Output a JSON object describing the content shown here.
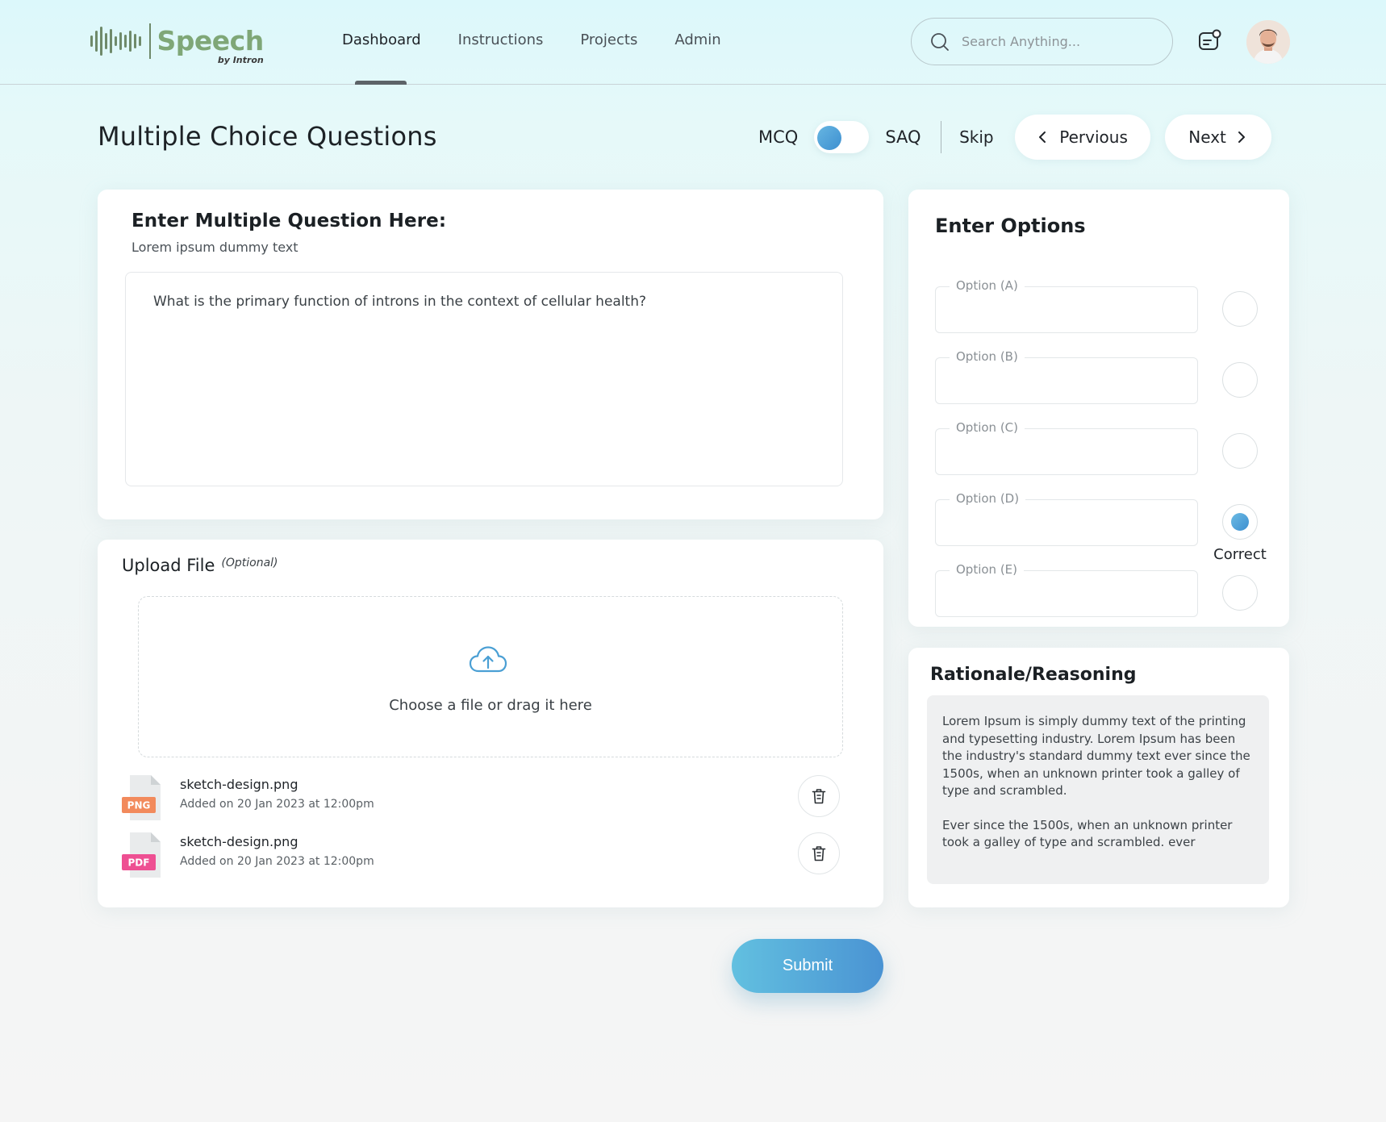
{
  "brand": {
    "name": "Speech",
    "sub": "by Intron",
    "color": "#7fa777"
  },
  "nav": {
    "items": [
      {
        "label": "Dashboard",
        "active": true
      },
      {
        "label": "Instructions",
        "active": false
      },
      {
        "label": "Projects",
        "active": false
      },
      {
        "label": "Admin",
        "active": false
      }
    ]
  },
  "search": {
    "placeholder": "Search Anything...",
    "icon": "search-icon"
  },
  "header_icons": {
    "messages": "message-icon",
    "avatar": "user-avatar"
  },
  "page": {
    "title": "Multiple Choice Questions"
  },
  "mode": {
    "left": "MCQ",
    "right": "SAQ",
    "selected": "MCQ"
  },
  "actions": {
    "skip": "Skip",
    "previous": "Pervious",
    "next": "Next",
    "submit": "Submit"
  },
  "question": {
    "title": "Enter Multiple Question Here:",
    "subtitle": "Lorem ipsum dummy text",
    "value": "What is the primary function of introns in the context of cellular health?"
  },
  "upload": {
    "title": "Upload File",
    "optional": "(Optional)",
    "drop_text": "Choose a file or drag it here",
    "files": [
      {
        "name": "sketch-design.png",
        "meta": "Added on 20 Jan 2023 at 12:00pm",
        "type": "PNG",
        "badge_color": "#f28a5c"
      },
      {
        "name": "sketch-design.png",
        "meta": "Added on 20 Jan 2023 at 12:00pm",
        "type": "PDF",
        "badge_color": "#ee4f92"
      }
    ]
  },
  "options": {
    "title": "Enter Options",
    "items": [
      {
        "label": "Option (A)",
        "value": "",
        "correct": false
      },
      {
        "label": "Option (B)",
        "value": "",
        "correct": false
      },
      {
        "label": "Option (C)",
        "value": "",
        "correct": false
      },
      {
        "label": "Option (D)",
        "value": "",
        "correct": true
      },
      {
        "label": "Option (E)",
        "value": "",
        "correct": false
      }
    ],
    "correct_label": "Correct"
  },
  "rationale": {
    "title": "Rationale/Reasoning",
    "paragraphs": [
      "Lorem Ipsum is simply dummy text of the printing and typesetting industry. Lorem Ipsum has been the industry's standard dummy text ever since the 1500s, when an unknown printer took a galley of type and scrambled.",
      "Ever since the 1500s, when an unknown printer took a galley of type and scrambled. ever"
    ]
  },
  "colors": {
    "accent": "#4a93d3",
    "accent_light": "#62c0e0"
  }
}
